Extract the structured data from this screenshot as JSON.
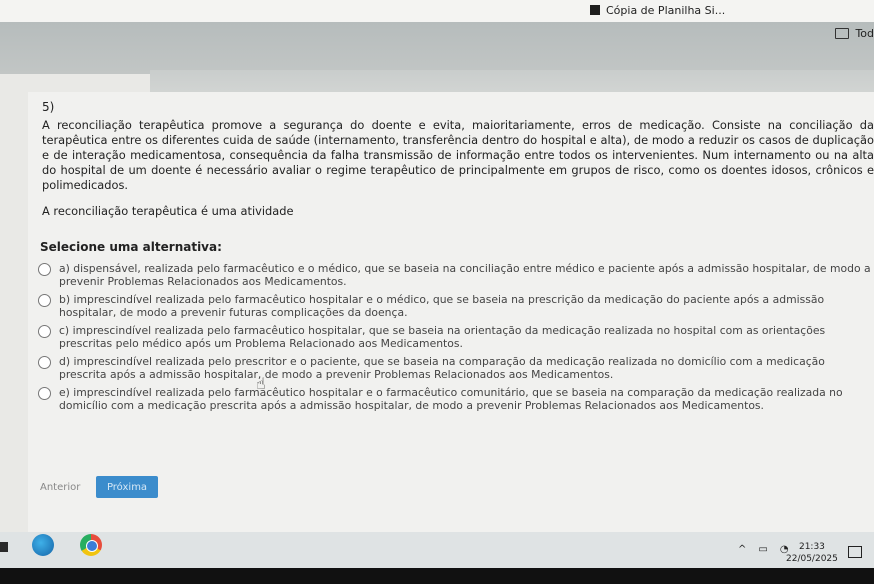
{
  "topbar": {
    "file_tab": "Cópia de Planilha Si...",
    "folder_label": "Tod"
  },
  "question": {
    "number": "5)",
    "stem": "A reconciliação terapêutica promove a segurança do doente e evita, maioritariamente, erros de medicação. Consiste na conciliação da terapêutica entre os diferentes cuida de saúde (internamento, transferência dentro do hospital e alta), de modo a reduzir os casos de duplicação e de interação medicamentosa, consequência da falha transmissão de informação entre todos os intervenientes. Num internamento ou na alta do hospital de um doente é necessário avaliar o regime terapêutico de principalmente em grupos de risco, como os doentes idosos, crônicos e polimedicados.",
    "stem_2": "A reconciliação terapêutica é uma atividade",
    "select_prompt": "Selecione uma alternativa:",
    "options": [
      {
        "text": "a) dispensável, realizada pelo farmacêutico e o médico, que se baseia na conciliação entre médico e paciente após a admissão hospitalar, de modo a prevenir Problemas Relacionados aos Medicamentos."
      },
      {
        "text": "b) imprescindível realizada pelo farmacêutico hospitalar e o médico, que se baseia na prescrição da medicação do paciente após a admissão hospitalar, de modo a prevenir futuras complicações da doença."
      },
      {
        "text": "c) imprescindível realizada pelo farmacêutico hospitalar, que se baseia na orientação da medicação realizada no hospital com as orientações prescritas pelo médico após um Problema Relacionado aos Medicamentos."
      },
      {
        "text": "d) imprescindível realizada pelo prescritor e o paciente, que se baseia na comparação da medicação realizada no domicílio com a medicação prescrita após a admissão hospitalar, de modo a prevenir Problemas Relacionados aos Medicamentos."
      },
      {
        "text": "e) imprescindível realizada pelo farmacêutico hospitalar e o farmacêutico comunitário, que se baseia na comparação da medicação realizada no domicílio com a medicação prescrita após a admissão hospitalar, de modo a prevenir Problemas Relacionados aos Medicamentos."
      }
    ]
  },
  "nav": {
    "prev_label": "Anterior",
    "next_label": "Próxima"
  },
  "taskbar": {
    "time": "21:33",
    "date": "22/05/2025"
  },
  "colors": {
    "next_button": "#3b8ccc",
    "header_band": "#b6bcbc"
  }
}
